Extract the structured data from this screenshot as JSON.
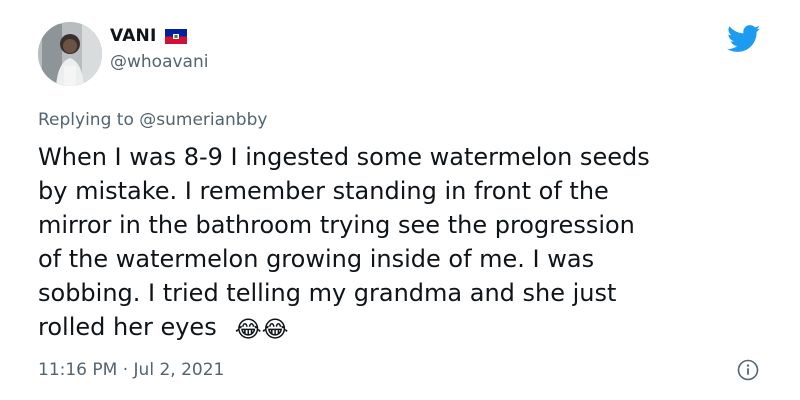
{
  "author": {
    "display_name": "VANI",
    "handle": "@whoavani",
    "flag_icon": "haiti-flag-icon",
    "avatar_icon": "profile-photo"
  },
  "platform_icon": "twitter-bird-icon",
  "reply": {
    "prefix": "Replying to",
    "mention": "@sumerianbby"
  },
  "tweet": {
    "lines": [
      "When I was 8-9 I ingested some watermelon seeds",
      "by mistake. I remember standing in front of the",
      "mirror in the bathroom trying see the progression",
      "of the watermelon growing inside of me. I was",
      "sobbing. I tried telling my grandma and she just",
      "rolled her eyes"
    ],
    "emojis": [
      "😂",
      "😂"
    ],
    "emoji_icon": "face-with-tears-of-joy-icon"
  },
  "meta": {
    "timestamp": "11:16 PM · Jul 2, 2021",
    "info_icon": "info-icon"
  },
  "colors": {
    "text": "#0f1419",
    "secondary": "#536471",
    "twitter_blue": "#1d9bf0"
  }
}
